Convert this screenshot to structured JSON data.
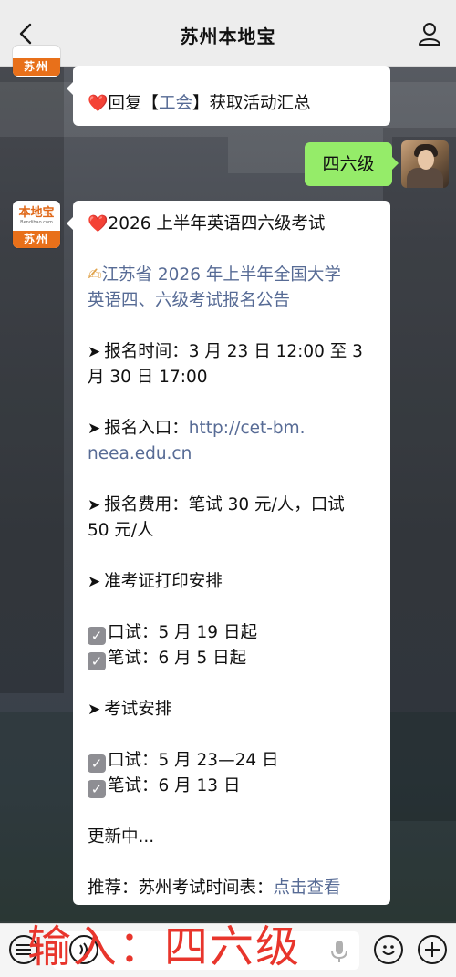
{
  "header": {
    "title": "苏州本地宝"
  },
  "logo": {
    "brand": "本地宝",
    "domain": "Bendibao.com",
    "city": "苏州"
  },
  "messages": {
    "top_reply": {
      "emoji": "❤️",
      "prefix": "回复【",
      "keyword": "工会",
      "suffix": "】获取活动汇总"
    },
    "user_message": "四六级",
    "main": {
      "title_emoji": "❤️",
      "title": "2026 上半年英语四六级考试",
      "notice_emoji": "✍",
      "notice_line1": "江苏省 2026 年上半年全国大学",
      "notice_line2": "英语四、六级考试报名公告",
      "arrow": "➤",
      "reg_time_line1": "报名时间：3 月 23 日 12:00 至 3",
      "reg_time_line2": "月 30 日 17:00",
      "reg_entry_label": "报名入口：",
      "reg_entry_link1": "http://cet-bm.",
      "reg_entry_link2": "neea.edu.cn",
      "fee_line1": "报名费用：笔试 30 元/人，口试",
      "fee_line2": "50 元/人",
      "admit_title": "准考证打印安排",
      "admit_oral": "口试：5 月 19 日起",
      "admit_written": "笔试：6 月 5 日起",
      "exam_title": "考试安排",
      "exam_oral": "口试：5 月 23—24 日",
      "exam_written": "笔试：6 月 13 日",
      "updating": "更新中...",
      "recommend_label": "推荐：苏州考试时间表：",
      "recommend_link": "点击查看"
    }
  },
  "overlay_text": "输入：四六级",
  "icons": {
    "back": "chevron-left-icon",
    "profile": "person-icon",
    "menu": "keyboard-menu-icon",
    "voice": "voice-icon",
    "mic": "microphone-icon",
    "emoji": "emoji-icon",
    "plus": "plus-icon"
  },
  "colors": {
    "link": "#576b95",
    "user_bubble": "#95ec69",
    "overlay": "#e8352c",
    "brand_orange": "#e8701a"
  }
}
